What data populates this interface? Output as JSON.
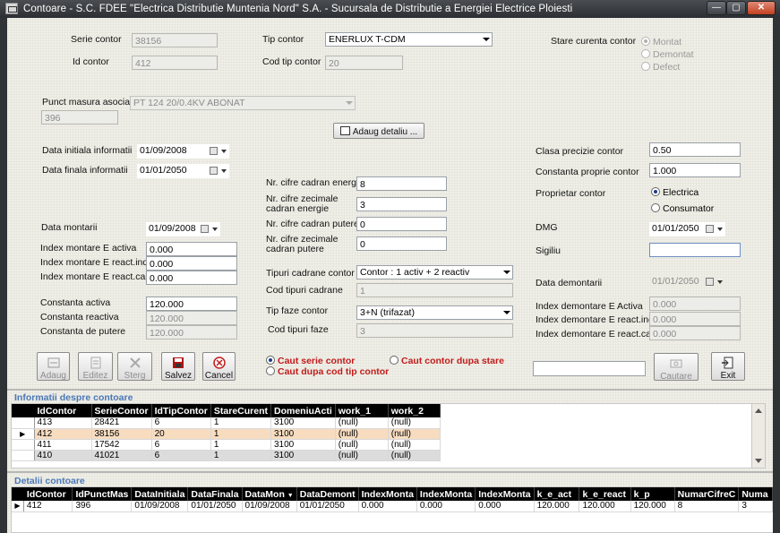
{
  "window": {
    "title": "Contoare - S.C. FDEE \"Electrica Distributie Muntenia Nord\" S.A. - Sucursala de Distributie a Energiei Electrice Ploiesti",
    "min": "—",
    "max": "▢",
    "close": "✕"
  },
  "form": {
    "serie_contor_label": "Serie contor",
    "serie_contor": "38156",
    "id_contor_label": "Id contor",
    "id_contor": "412",
    "tip_contor_label": "Tip contor",
    "tip_contor": "ENERLUX T-CDM",
    "cod_tip_contor_label": "Cod tip contor",
    "cod_tip_contor": "20",
    "stare_label": "Stare curenta contor",
    "stare_montat": "Montat",
    "stare_demontat": "Demontat",
    "stare_defect": "Defect",
    "punct_masura_label": "Punct masura asociat",
    "punct_masura": "PT 124 20/0.4KV ABONAT",
    "punct_masura_id": "396",
    "adaug_detaliu": "Adaug detaliu ...",
    "data_initiala_label": "Data initiala informatii",
    "data_initiala": "01/09/2008",
    "data_finala_label": "Data finala informatii",
    "data_finala": "01/01/2050",
    "nr_cifre_energie_label": "Nr. cifre cadran energie",
    "nr_cifre_energie": "8",
    "nr_cifre_zec_energie_label1": "Nr. cifre zecimale",
    "nr_cifre_zec_energie_label2": "cadran energie",
    "nr_cifre_zec_energie": "3",
    "nr_cifre_putere_label": "Nr. cifre cadran putere",
    "nr_cifre_putere": "0",
    "nr_cifre_zec_putere_label1": "Nr. cifre zecimale",
    "nr_cifre_zec_putere_label2": "cadran putere",
    "nr_cifre_zec_putere": "0",
    "data_montarii_label": "Data montarii",
    "data_montarii": "01/09/2008",
    "index_activa_label": "Index montare E activa",
    "index_activa": "0.000",
    "index_react_label": "Index montare E react.ind.",
    "index_react": "0.000",
    "index_capacit_label": "Index montare E react.capacit",
    "index_capacit": "0.000",
    "tipuri_cadrane_label": "Tipuri cadrane contor",
    "tipuri_cadrane": "Contor : 1 activ + 2 reactiv",
    "cod_tipuri_cadrane_label": "Cod tipuri cadrane",
    "cod_tipuri_cadrane": "1",
    "tip_faze_label": "Tip faze contor",
    "tip_faze": "3+N (trifazat)",
    "cod_tip_faze_label": "Cod tipuri faze",
    "cod_tip_faze": "3",
    "constanta_activa_label": "Constanta activa",
    "constanta_activa": "120.000",
    "constanta_reactiva_label": "Constanta reactiva",
    "constanta_reactiva": "120.000",
    "constanta_putere_label": "Constanta de putere",
    "constanta_putere": "120.000",
    "clasa_precizie_label": "Clasa precizie contor",
    "clasa_precizie": "0.50",
    "constanta_proprie_label": "Constanta proprie contor",
    "constanta_proprie": "1.000",
    "proprietar_label": "Proprietar contor",
    "proprietar_electrica": "Electrica",
    "proprietar_consumator": "Consumator",
    "dmg_label": "DMG",
    "dmg": "01/01/2050",
    "sigiliu_label": "Sigiliu",
    "sigiliu": "",
    "data_demontarii_label": "Data demontarii",
    "data_demontarii": "01/01/2050",
    "idx_dem_activa_label": "Index demontare E Activa",
    "idx_dem_activa": "0.000",
    "idx_dem_react_label": "Index demontare E react.ind.",
    "idx_dem_react": "0.000",
    "idx_dem_capacit_label": "Index demontare E react.capacit",
    "idx_dem_capacit": "0.000"
  },
  "toolbar": {
    "adaug": "Adaug",
    "editez": "Editez",
    "sterg": "Sterg",
    "salvez": "Salvez",
    "cancel": "Cancel",
    "search_serie": "Caut serie contor",
    "search_cod_tip": "Caut dupa cod tip contor",
    "search_stare": "Caut contor dupa stare",
    "search_value": "",
    "cautare": "Cautare",
    "exit": "Exit"
  },
  "grid1": {
    "title": "Informatii despre contoare",
    "columns": [
      "IdContor",
      "SerieContor",
      "IdTipContor",
      "StareCurent",
      "DomeniuActi",
      "work_1",
      "work_2"
    ],
    "rows": [
      [
        "413",
        "28421",
        "6",
        "1",
        "3100",
        "(null)",
        "(null)"
      ],
      [
        "412",
        "38156",
        "20",
        "1",
        "3100",
        "(null)",
        "(null)"
      ],
      [
        "411",
        "17542",
        "6",
        "1",
        "3100",
        "(null)",
        "(null)"
      ],
      [
        "410",
        "41021",
        "6",
        "1",
        "3100",
        "(null)",
        "(null)"
      ]
    ]
  },
  "grid2": {
    "title": "Detalii contoare",
    "columns": [
      "IdContor",
      "IdPunctMas",
      "DataInitiala",
      "DataFinala",
      "DataMon",
      "DataDemont",
      "IndexMonta",
      "IndexMonta",
      "IndexMonta",
      "k_e_act",
      "k_e_react",
      "k_p",
      "NumarCifreC",
      "Numa"
    ],
    "rows": [
      [
        "412",
        "396",
        "01/09/2008",
        "01/01/2050",
        "01/09/2008",
        "01/01/2050",
        "0.000",
        "0.000",
        "0.000",
        "120.000",
        "120.000",
        "120.000",
        "8",
        "3"
      ]
    ]
  }
}
